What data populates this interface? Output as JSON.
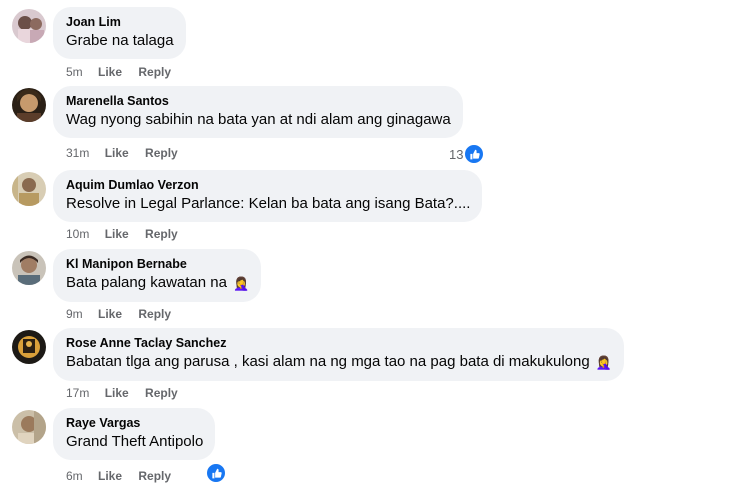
{
  "comments": [
    {
      "author": "Joan Lim",
      "text": "Grabe na talaga",
      "emoji": "",
      "time": "5m",
      "like": "Like",
      "reply": "Reply",
      "reactions": ""
    },
    {
      "author": "Marenella Santos",
      "text": "Wag nyong sabihin na bata yan at ndi alam ang ginagawa",
      "emoji": "",
      "time": "31m",
      "like": "Like",
      "reply": "Reply",
      "reactions": "13"
    },
    {
      "author": "Aquim Dumlao Verzon",
      "text": "Resolve in Legal Parlance: Kelan ba bata ang isang Bata?....",
      "emoji": "",
      "time": "10m",
      "like": "Like",
      "reply": "Reply",
      "reactions": ""
    },
    {
      "author": "Kl Manipon Bernabe",
      "text": "Bata palang kawatan na",
      "emoji": "🤦‍♀️",
      "time": "9m",
      "like": "Like",
      "reply": "Reply",
      "reactions": ""
    },
    {
      "author": "Rose Anne Taclay Sanchez",
      "text": "Babatan tlga ang parusa , kasi alam na ng mga tao na pag bata di makukulong",
      "emoji": "🤦‍♀️",
      "time": "17m",
      "like": "Like",
      "reply": "Reply",
      "reactions": ""
    },
    {
      "author": "Raye Vargas",
      "text": "Grand Theft Antipolo",
      "emoji": "",
      "time": "6m",
      "like": "Like",
      "reply": "Reply",
      "reactions": ""
    }
  ],
  "colors": {
    "bubble": "#f0f2f5",
    "meta": "#65676b",
    "like_blue": "#1877f2"
  },
  "icons": {
    "reaction": "like-thumb-icon"
  }
}
